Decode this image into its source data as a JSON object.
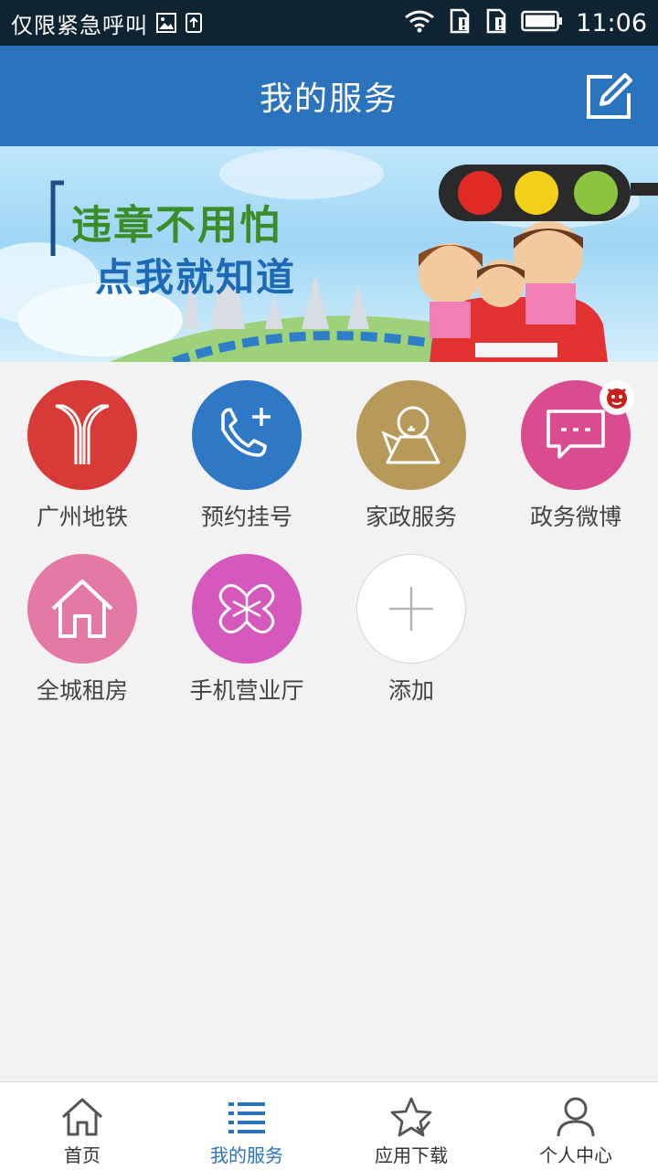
{
  "status_bar": {
    "carrier_text": "仅限紧急呼叫",
    "time": "11:06"
  },
  "header": {
    "title": "我的服务"
  },
  "banner": {
    "line1": "违章不用怕",
    "line2": "点我就知道"
  },
  "services": [
    {
      "label": "广州地铁",
      "color": "#d83a37",
      "icon": "metro-icon"
    },
    {
      "label": "预约挂号",
      "color": "#2f78c6",
      "icon": "phone-plus-icon"
    },
    {
      "label": "家政服务",
      "color": "#b79a5a",
      "icon": "kettle-icon"
    },
    {
      "label": "政务微博",
      "color": "#d94c8f",
      "icon": "chat-bubble-icon"
    },
    {
      "label": "全城租房",
      "color": "#e37aa6",
      "icon": "house-icon"
    },
    {
      "label": "手机营业厅",
      "color": "#d558bd",
      "icon": "knot-icon"
    },
    {
      "label": "添加",
      "color": "#ffffff",
      "icon": "plus-icon"
    }
  ],
  "bottom_nav": {
    "items": [
      {
        "label": "首页",
        "icon": "home-icon"
      },
      {
        "label": "我的服务",
        "icon": "list-icon"
      },
      {
        "label": "应用下载",
        "icon": "star-icon"
      },
      {
        "label": "个人中心",
        "icon": "user-icon"
      }
    ],
    "active_index": 1
  },
  "colors": {
    "header_bg": "#2b73bd",
    "status_bar_bg": "#0f2433",
    "active_nav": "#2b73bd"
  }
}
